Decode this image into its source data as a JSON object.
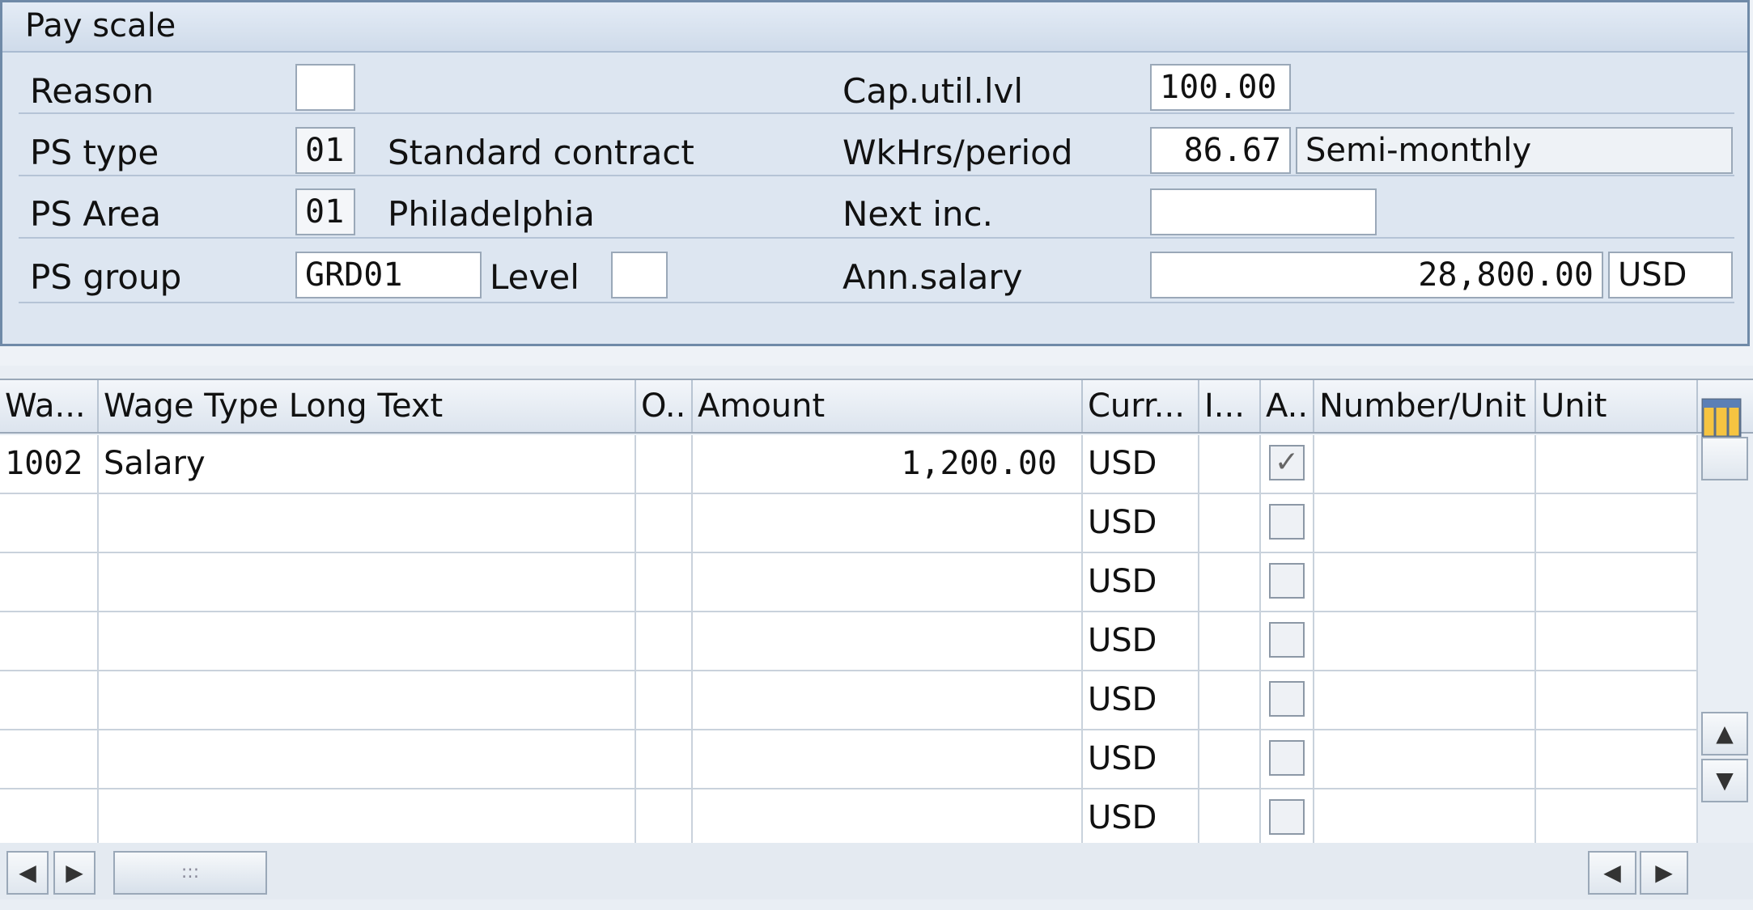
{
  "panel": {
    "title": "Pay scale",
    "reason_label": "Reason",
    "reason_value": "",
    "ps_type_label": "PS type",
    "ps_type_value": "01",
    "ps_type_text": "Standard contract",
    "ps_area_label": "PS Area",
    "ps_area_value": "01",
    "ps_area_text": "Philadelphia",
    "ps_group_label": "PS group",
    "ps_group_value": "GRD01",
    "level_label": "Level",
    "level_value": "",
    "cap_label": "Cap.util.lvl",
    "cap_value": "100.00",
    "wkhrs_label": "WkHrs/period",
    "wkhrs_value": "86.67",
    "wkhrs_period": "Semi-monthly",
    "next_inc_label": "Next inc.",
    "next_inc_value": "",
    "ann_salary_label": "Ann.salary",
    "ann_salary_value": "28,800.00",
    "ann_salary_currency": "USD"
  },
  "table": {
    "headers": [
      "Wa...",
      "Wage Type Long Text",
      "O..",
      "Amount",
      "Curr...",
      "I...",
      "A..",
      "Number/Unit",
      "Unit"
    ],
    "rows": [
      {
        "wt": "1002",
        "text": "Salary",
        "o": "",
        "amount": "1,200.00",
        "curr": "USD",
        "i": "",
        "a": true,
        "num": "",
        "unit": ""
      },
      {
        "wt": "",
        "text": "",
        "o": "",
        "amount": "",
        "curr": "USD",
        "i": "",
        "a": false,
        "num": "",
        "unit": ""
      },
      {
        "wt": "",
        "text": "",
        "o": "",
        "amount": "",
        "curr": "USD",
        "i": "",
        "a": false,
        "num": "",
        "unit": ""
      },
      {
        "wt": "",
        "text": "",
        "o": "",
        "amount": "",
        "curr": "USD",
        "i": "",
        "a": false,
        "num": "",
        "unit": ""
      },
      {
        "wt": "",
        "text": "",
        "o": "",
        "amount": "",
        "curr": "USD",
        "i": "",
        "a": false,
        "num": "",
        "unit": ""
      },
      {
        "wt": "",
        "text": "",
        "o": "",
        "amount": "",
        "curr": "USD",
        "i": "",
        "a": false,
        "num": "",
        "unit": ""
      },
      {
        "wt": "",
        "text": "",
        "o": "",
        "amount": "",
        "curr": "USD",
        "i": "",
        "a": false,
        "num": "",
        "unit": ""
      }
    ],
    "check_mark": "✓",
    "scroll_thumb_grip": ":::"
  },
  "icons": {
    "settings": "table-settings-icon",
    "scroll_up": "arrow-up-icon",
    "scroll_down": "arrow-down-icon",
    "scroll_left": "arrow-left-icon",
    "scroll_right": "arrow-right-icon"
  }
}
